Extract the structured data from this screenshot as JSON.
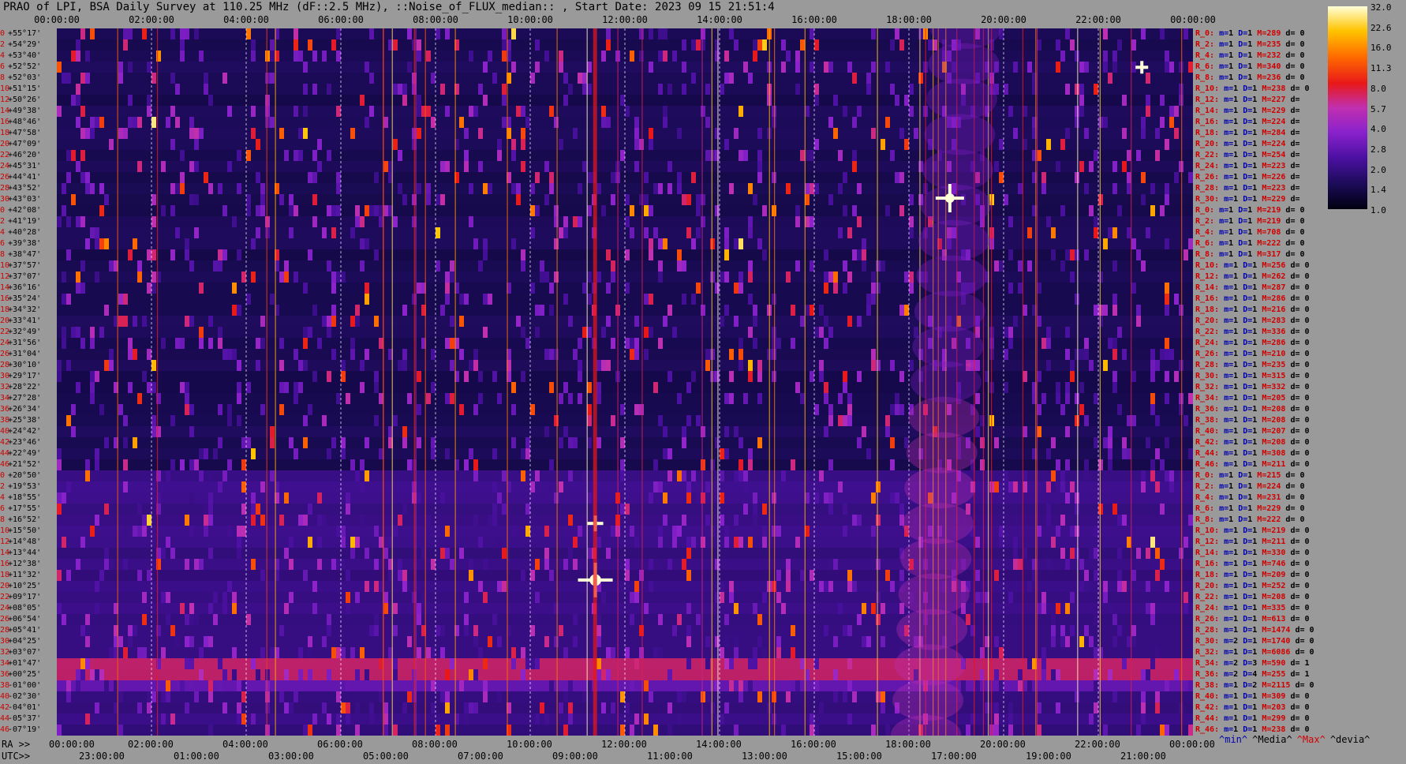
{
  "title": "PRAO of LPI, BSA Daily Survey at 110.25 MHz (dF::2.5 MHz), ::Noise_of_FLUX_median:: , Start Date: 2023 09 15 21:51:4",
  "chart_data": {
    "type": "heatmap",
    "title": "PRAO of LPI, BSA Daily Survey at 110.25 MHz (dF::2.5 MHz), ::Noise_of_FLUX_median:: , Start Date: 2023 09 15 21:51:4",
    "x_top_ticks": [
      "00:00:00",
      "02:00:00",
      "04:00:00",
      "06:00:00",
      "08:00:00",
      "10:00:00",
      "12:00:00",
      "14:00:00",
      "16:00:00",
      "18:00:00",
      "20:00:00",
      "22:00:00",
      "00:00:00"
    ],
    "ra_prefix": "RA >>",
    "ra_ticks": [
      "00:00:00",
      "02:00:00",
      "04:00:00",
      "06:00:00",
      "08:00:00",
      "10:00:00",
      "12:00:00",
      "14:00:00",
      "16:00:00",
      "18:00:00",
      "20:00:00",
      "22:00:00",
      "00:00:00"
    ],
    "utc_prefix": "UTC>>",
    "utc_ticks": [
      "23:00:00",
      "01:00:00",
      "03:00:00",
      "05:00:00",
      "07:00:00",
      "09:00:00",
      "11:00:00",
      "13:00:00",
      "15:00:00",
      "17:00:00",
      "19:00:00",
      "21:00:00"
    ],
    "rows": [
      {
        "idx": "0",
        "dec": "+55°17'"
      },
      {
        "idx": "2",
        "dec": "+54°29'"
      },
      {
        "idx": "4",
        "dec": "+53°40'"
      },
      {
        "idx": "6",
        "dec": "+52°52'"
      },
      {
        "idx": "8",
        "dec": "+52°03'"
      },
      {
        "idx": "10",
        "dec": "+51°15'"
      },
      {
        "idx": "12",
        "dec": "+50°26'"
      },
      {
        "idx": "14",
        "dec": "+49°38'"
      },
      {
        "idx": "16",
        "dec": "+48°46'"
      },
      {
        "idx": "18",
        "dec": "+47°58'"
      },
      {
        "idx": "20",
        "dec": "+47°09'"
      },
      {
        "idx": "22",
        "dec": "+46°20'"
      },
      {
        "idx": "24",
        "dec": "+45°31'"
      },
      {
        "idx": "26",
        "dec": "+44°41'"
      },
      {
        "idx": "28",
        "dec": "+43°52'"
      },
      {
        "idx": "30",
        "dec": "+43°03'"
      },
      {
        "idx": "0",
        "dec": "+42°08'"
      },
      {
        "idx": "2",
        "dec": "+41°19'"
      },
      {
        "idx": "4",
        "dec": "+40°28'"
      },
      {
        "idx": "6",
        "dec": "+39°38'"
      },
      {
        "idx": "8",
        "dec": "+38°47'"
      },
      {
        "idx": "10",
        "dec": "+37°57'"
      },
      {
        "idx": "12",
        "dec": "+37°07'"
      },
      {
        "idx": "14",
        "dec": "+36°16'"
      },
      {
        "idx": "16",
        "dec": "+35°24'"
      },
      {
        "idx": "18",
        "dec": "+34°32'"
      },
      {
        "idx": "20",
        "dec": "+33°41'"
      },
      {
        "idx": "22",
        "dec": "+32°49'"
      },
      {
        "idx": "24",
        "dec": "+31°56'"
      },
      {
        "idx": "26",
        "dec": "+31°04'"
      },
      {
        "idx": "28",
        "dec": "+30°10'"
      },
      {
        "idx": "30",
        "dec": "+29°17'"
      },
      {
        "idx": "32",
        "dec": "+28°22'"
      },
      {
        "idx": "34",
        "dec": "+27°28'"
      },
      {
        "idx": "36",
        "dec": "+26°34'"
      },
      {
        "idx": "38",
        "dec": "+25°38'"
      },
      {
        "idx": "40",
        "dec": "+24°42'"
      },
      {
        "idx": "42",
        "dec": "+23°46'"
      },
      {
        "idx": "44",
        "dec": "+22°49'"
      },
      {
        "idx": "46",
        "dec": "+21°52'"
      },
      {
        "idx": "0",
        "dec": "+20°50'"
      },
      {
        "idx": "2",
        "dec": "+19°53'"
      },
      {
        "idx": "4",
        "dec": "+18°55'"
      },
      {
        "idx": "6",
        "dec": "+17°55'"
      },
      {
        "idx": "8",
        "dec": "+16°52'"
      },
      {
        "idx": "10",
        "dec": "+15°50'"
      },
      {
        "idx": "12",
        "dec": "+14°48'"
      },
      {
        "idx": "14",
        "dec": "+13°44'"
      },
      {
        "idx": "16",
        "dec": "+12°38'"
      },
      {
        "idx": "18",
        "dec": "+11°32'"
      },
      {
        "idx": "20",
        "dec": "+10°25'"
      },
      {
        "idx": "22",
        "dec": "+09°17'"
      },
      {
        "idx": "24",
        "dec": "+08°05'"
      },
      {
        "idx": "26",
        "dec": "+06°54'"
      },
      {
        "idx": "28",
        "dec": "+05°41'"
      },
      {
        "idx": "30",
        "dec": "+04°25'"
      },
      {
        "idx": "32",
        "dec": "+03°07'"
      },
      {
        "idx": "34",
        "dec": "+01°47'"
      },
      {
        "idx": "36",
        "dec": "+00°25'"
      },
      {
        "idx": "38",
        "dec": "-01°00'"
      },
      {
        "idx": "40",
        "dec": "-02°30'"
      },
      {
        "idx": "42",
        "dec": "-04°01'"
      },
      {
        "idx": "44",
        "dec": "-05°37'"
      },
      {
        "idx": "46",
        "dec": "-07°19'"
      }
    ],
    "row_stats": [
      {
        "r": "R_0:",
        "m": "1",
        "d": "1",
        "M": "289",
        "dev": "0"
      },
      {
        "r": "R_2:",
        "m": "1",
        "d": "1",
        "M": "235",
        "dev": "0"
      },
      {
        "r": "R_4:",
        "m": "1",
        "d": "1",
        "M": "232",
        "dev": "0"
      },
      {
        "r": "R_6:",
        "m": "1",
        "d": "1",
        "M": "340",
        "dev": "0"
      },
      {
        "r": "R_8:",
        "m": "1",
        "d": "1",
        "M": "236",
        "dev": "0"
      },
      {
        "r": "R_10:",
        "m": "1",
        "d": "1",
        "M": "238",
        "dev": "0"
      },
      {
        "r": "R_12:",
        "m": "1",
        "d": "1",
        "M": "227",
        "dev": ""
      },
      {
        "r": "R_14:",
        "m": "1",
        "d": "1",
        "M": "229",
        "dev": ""
      },
      {
        "r": "R_16:",
        "m": "1",
        "d": "1",
        "M": "224",
        "dev": ""
      },
      {
        "r": "R_18:",
        "m": "1",
        "d": "1",
        "M": "284",
        "dev": ""
      },
      {
        "r": "R_20:",
        "m": "1",
        "d": "1",
        "M": "224",
        "dev": ""
      },
      {
        "r": "R_22:",
        "m": "1",
        "d": "1",
        "M": "254",
        "dev": ""
      },
      {
        "r": "R_24:",
        "m": "1",
        "d": "1",
        "M": "223",
        "dev": ""
      },
      {
        "r": "R_26:",
        "m": "1",
        "d": "1",
        "M": "226",
        "dev": ""
      },
      {
        "r": "R_28:",
        "m": "1",
        "d": "1",
        "M": "223",
        "dev": ""
      },
      {
        "r": "R_30:",
        "m": "1",
        "d": "1",
        "M": "229",
        "dev": ""
      },
      {
        "r": "R_0:",
        "m": "1",
        "d": "1",
        "M": "219",
        "dev": "0"
      },
      {
        "r": "R_2:",
        "m": "1",
        "d": "1",
        "M": "219",
        "dev": "0"
      },
      {
        "r": "R_4:",
        "m": "1",
        "d": "1",
        "M": "708",
        "dev": "0"
      },
      {
        "r": "R_6:",
        "m": "1",
        "d": "1",
        "M": "222",
        "dev": "0"
      },
      {
        "r": "R_8:",
        "m": "1",
        "d": "1",
        "M": "317",
        "dev": "0"
      },
      {
        "r": "R_10:",
        "m": "1",
        "d": "1",
        "M": "256",
        "dev": "0"
      },
      {
        "r": "R_12:",
        "m": "1",
        "d": "1",
        "M": "262",
        "dev": "0"
      },
      {
        "r": "R_14:",
        "m": "1",
        "d": "1",
        "M": "287",
        "dev": "0"
      },
      {
        "r": "R_16:",
        "m": "1",
        "d": "1",
        "M": "286",
        "dev": "0"
      },
      {
        "r": "R_18:",
        "m": "1",
        "d": "1",
        "M": "216",
        "dev": "0"
      },
      {
        "r": "R_20:",
        "m": "1",
        "d": "1",
        "M": "283",
        "dev": "0"
      },
      {
        "r": "R_22:",
        "m": "1",
        "d": "1",
        "M": "336",
        "dev": "0"
      },
      {
        "r": "R_24:",
        "m": "1",
        "d": "1",
        "M": "286",
        "dev": "0"
      },
      {
        "r": "R_26:",
        "m": "1",
        "d": "1",
        "M": "210",
        "dev": "0"
      },
      {
        "r": "R_28:",
        "m": "1",
        "d": "1",
        "M": "235",
        "dev": "0"
      },
      {
        "r": "R_30:",
        "m": "1",
        "d": "1",
        "M": "315",
        "dev": "0"
      },
      {
        "r": "R_32:",
        "m": "1",
        "d": "1",
        "M": "332",
        "dev": "0"
      },
      {
        "r": "R_34:",
        "m": "1",
        "d": "1",
        "M": "205",
        "dev": "0"
      },
      {
        "r": "R_36:",
        "m": "1",
        "d": "1",
        "M": "208",
        "dev": "0"
      },
      {
        "r": "R_38:",
        "m": "1",
        "d": "1",
        "M": "208",
        "dev": "0"
      },
      {
        "r": "R_40:",
        "m": "1",
        "d": "1",
        "M": "207",
        "dev": "0"
      },
      {
        "r": "R_42:",
        "m": "1",
        "d": "1",
        "M": "208",
        "dev": "0"
      },
      {
        "r": "R_44:",
        "m": "1",
        "d": "1",
        "M": "308",
        "dev": "0"
      },
      {
        "r": "R_46:",
        "m": "1",
        "d": "1",
        "M": "211",
        "dev": "0"
      },
      {
        "r": "R_0:",
        "m": "1",
        "d": "1",
        "M": "215",
        "dev": "0"
      },
      {
        "r": "R_2:",
        "m": "1",
        "d": "1",
        "M": "224",
        "dev": "0"
      },
      {
        "r": "R_4:",
        "m": "1",
        "d": "1",
        "M": "231",
        "dev": "0"
      },
      {
        "r": "R_6:",
        "m": "1",
        "d": "1",
        "M": "229",
        "dev": "0"
      },
      {
        "r": "R_8:",
        "m": "1",
        "d": "1",
        "M": "222",
        "dev": "0"
      },
      {
        "r": "R_10:",
        "m": "1",
        "d": "1",
        "M": "219",
        "dev": "0"
      },
      {
        "r": "R_12:",
        "m": "1",
        "d": "1",
        "M": "211",
        "dev": "0"
      },
      {
        "r": "R_14:",
        "m": "1",
        "d": "1",
        "M": "330",
        "dev": "0"
      },
      {
        "r": "R_16:",
        "m": "1",
        "d": "1",
        "M": "746",
        "dev": "0"
      },
      {
        "r": "R_18:",
        "m": "1",
        "d": "1",
        "M": "209",
        "dev": "0"
      },
      {
        "r": "R_20:",
        "m": "1",
        "d": "1",
        "M": "252",
        "dev": "0"
      },
      {
        "r": "R_22:",
        "m": "1",
        "d": "1",
        "M": "208",
        "dev": "0"
      },
      {
        "r": "R_24:",
        "m": "1",
        "d": "1",
        "M": "335",
        "dev": "0"
      },
      {
        "r": "R_26:",
        "m": "1",
        "d": "1",
        "M": "613",
        "dev": "0"
      },
      {
        "r": "R_28:",
        "m": "1",
        "d": "1",
        "M": "1474",
        "dev": "0"
      },
      {
        "r": "R_30:",
        "m": "2",
        "d": "1",
        "M": "1740",
        "dev": "0"
      },
      {
        "r": "R_32:",
        "m": "1",
        "d": "1",
        "M": "6086",
        "dev": "0"
      },
      {
        "r": "R_34:",
        "m": "2",
        "d": "3",
        "M": "590",
        "dev": "1"
      },
      {
        "r": "R_36:",
        "m": "2",
        "d": "4",
        "M": "255",
        "dev": "1"
      },
      {
        "r": "R_38:",
        "m": "1",
        "d": "2",
        "M": "2115",
        "dev": "0"
      },
      {
        "r": "R_40:",
        "m": "1",
        "d": "1",
        "M": "309",
        "dev": "0"
      },
      {
        "r": "R_42:",
        "m": "1",
        "d": "1",
        "M": "203",
        "dev": "0"
      },
      {
        "r": "R_44:",
        "m": "1",
        "d": "1",
        "M": "299",
        "dev": "0"
      },
      {
        "r": "R_46:",
        "m": "1",
        "d": "1",
        "M": "238",
        "dev": "0"
      }
    ],
    "colorbar_labels": [
      "32.0",
      "22.6",
      "16.0",
      "11.3",
      "8.0",
      "5.7",
      "4.0",
      "2.8",
      "2.0",
      "1.4",
      "1.0"
    ],
    "legend": [
      {
        "text": "^min^",
        "color": "#0000b0"
      },
      {
        "text": "^Media^",
        "color": "#000000"
      },
      {
        "text": "^Max^",
        "color": "#d00000"
      },
      {
        "text": "^devia^",
        "color": "#000000"
      }
    ],
    "x_range_hours": [
      0,
      24
    ],
    "dec_range": [
      "+55°17'",
      "-07°19'"
    ]
  }
}
